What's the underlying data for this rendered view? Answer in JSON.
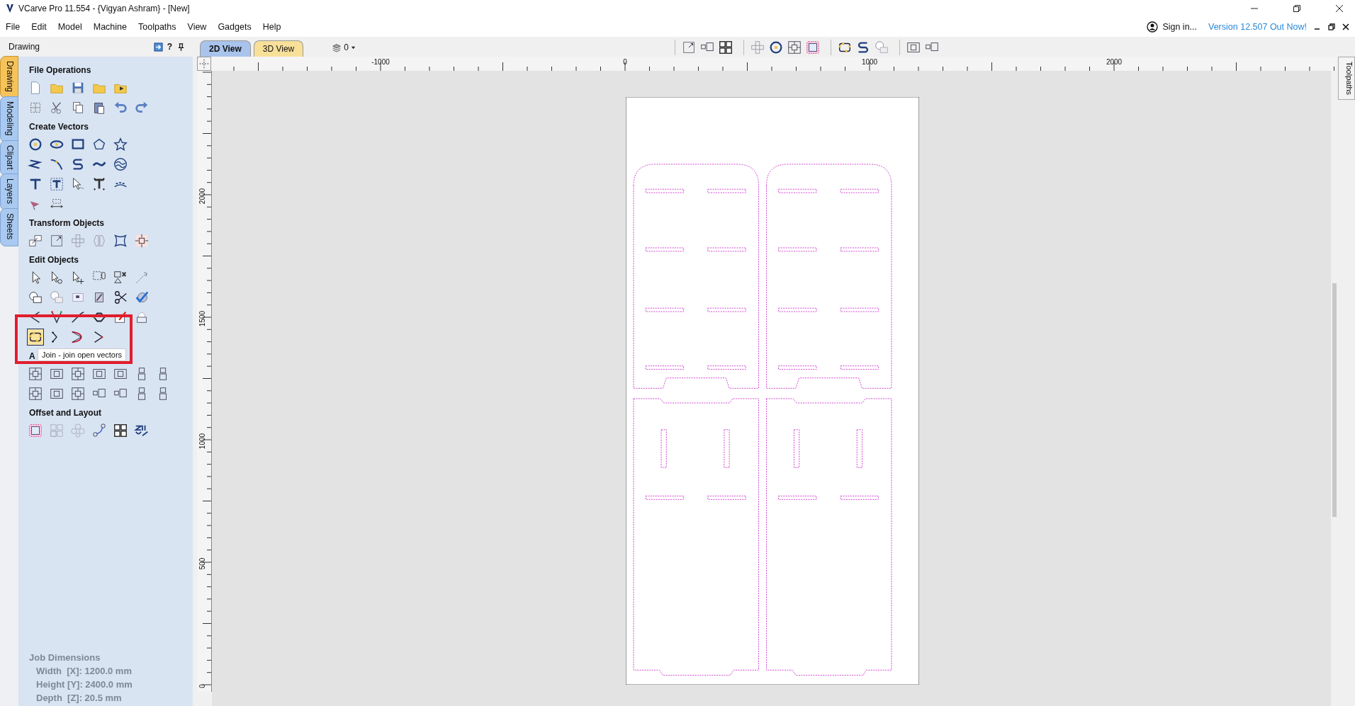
{
  "window": {
    "title": "VCarve Pro 11.554 - {Vigyan Ashram} - [New]"
  },
  "menu": [
    "File",
    "Edit",
    "Model",
    "Machine",
    "Toolpaths",
    "View",
    "Gadgets",
    "Help"
  ],
  "account": {
    "sign_in": "Sign in...",
    "update_link": "Version 12.507 Out Now!"
  },
  "panel": {
    "title": "Drawing",
    "help": "?"
  },
  "side_tabs": [
    {
      "label": "Drawing",
      "selected": true
    },
    {
      "label": "Modeling",
      "selected": false
    },
    {
      "label": "Clipart",
      "selected": false
    },
    {
      "label": "Layers",
      "selected": false
    },
    {
      "label": "Sheets",
      "selected": false
    }
  ],
  "sections": [
    {
      "title": "File Operations"
    },
    {
      "title": "Create Vectors"
    },
    {
      "title": "Transform Objects"
    },
    {
      "title": "Edit Objects"
    },
    {
      "title": "A"
    },
    {
      "title": "Offset and Layout"
    }
  ],
  "tooltip": {
    "text": "Join - join open vectors",
    "tool_highlighted": true
  },
  "job_dimensions": {
    "title": "Job Dimensions",
    "lines": [
      "Width  [X]: 1200.0 mm",
      "Height [Y]: 2400.0 mm",
      "Depth  [Z]: 20.5 mm"
    ],
    "disabled": true
  },
  "view_tabs": [
    {
      "label": "2D View",
      "selected": true
    },
    {
      "label": "3D View",
      "selected": false
    }
  ],
  "layer_dropdown": {
    "value": "0"
  },
  "right_tab": {
    "label": "Toolpaths"
  },
  "ruler": {
    "horizontal": [
      "-1000",
      "0",
      "1000",
      "2000"
    ],
    "vertical": [
      "2000",
      "1500",
      "1000",
      "500",
      "0"
    ]
  }
}
